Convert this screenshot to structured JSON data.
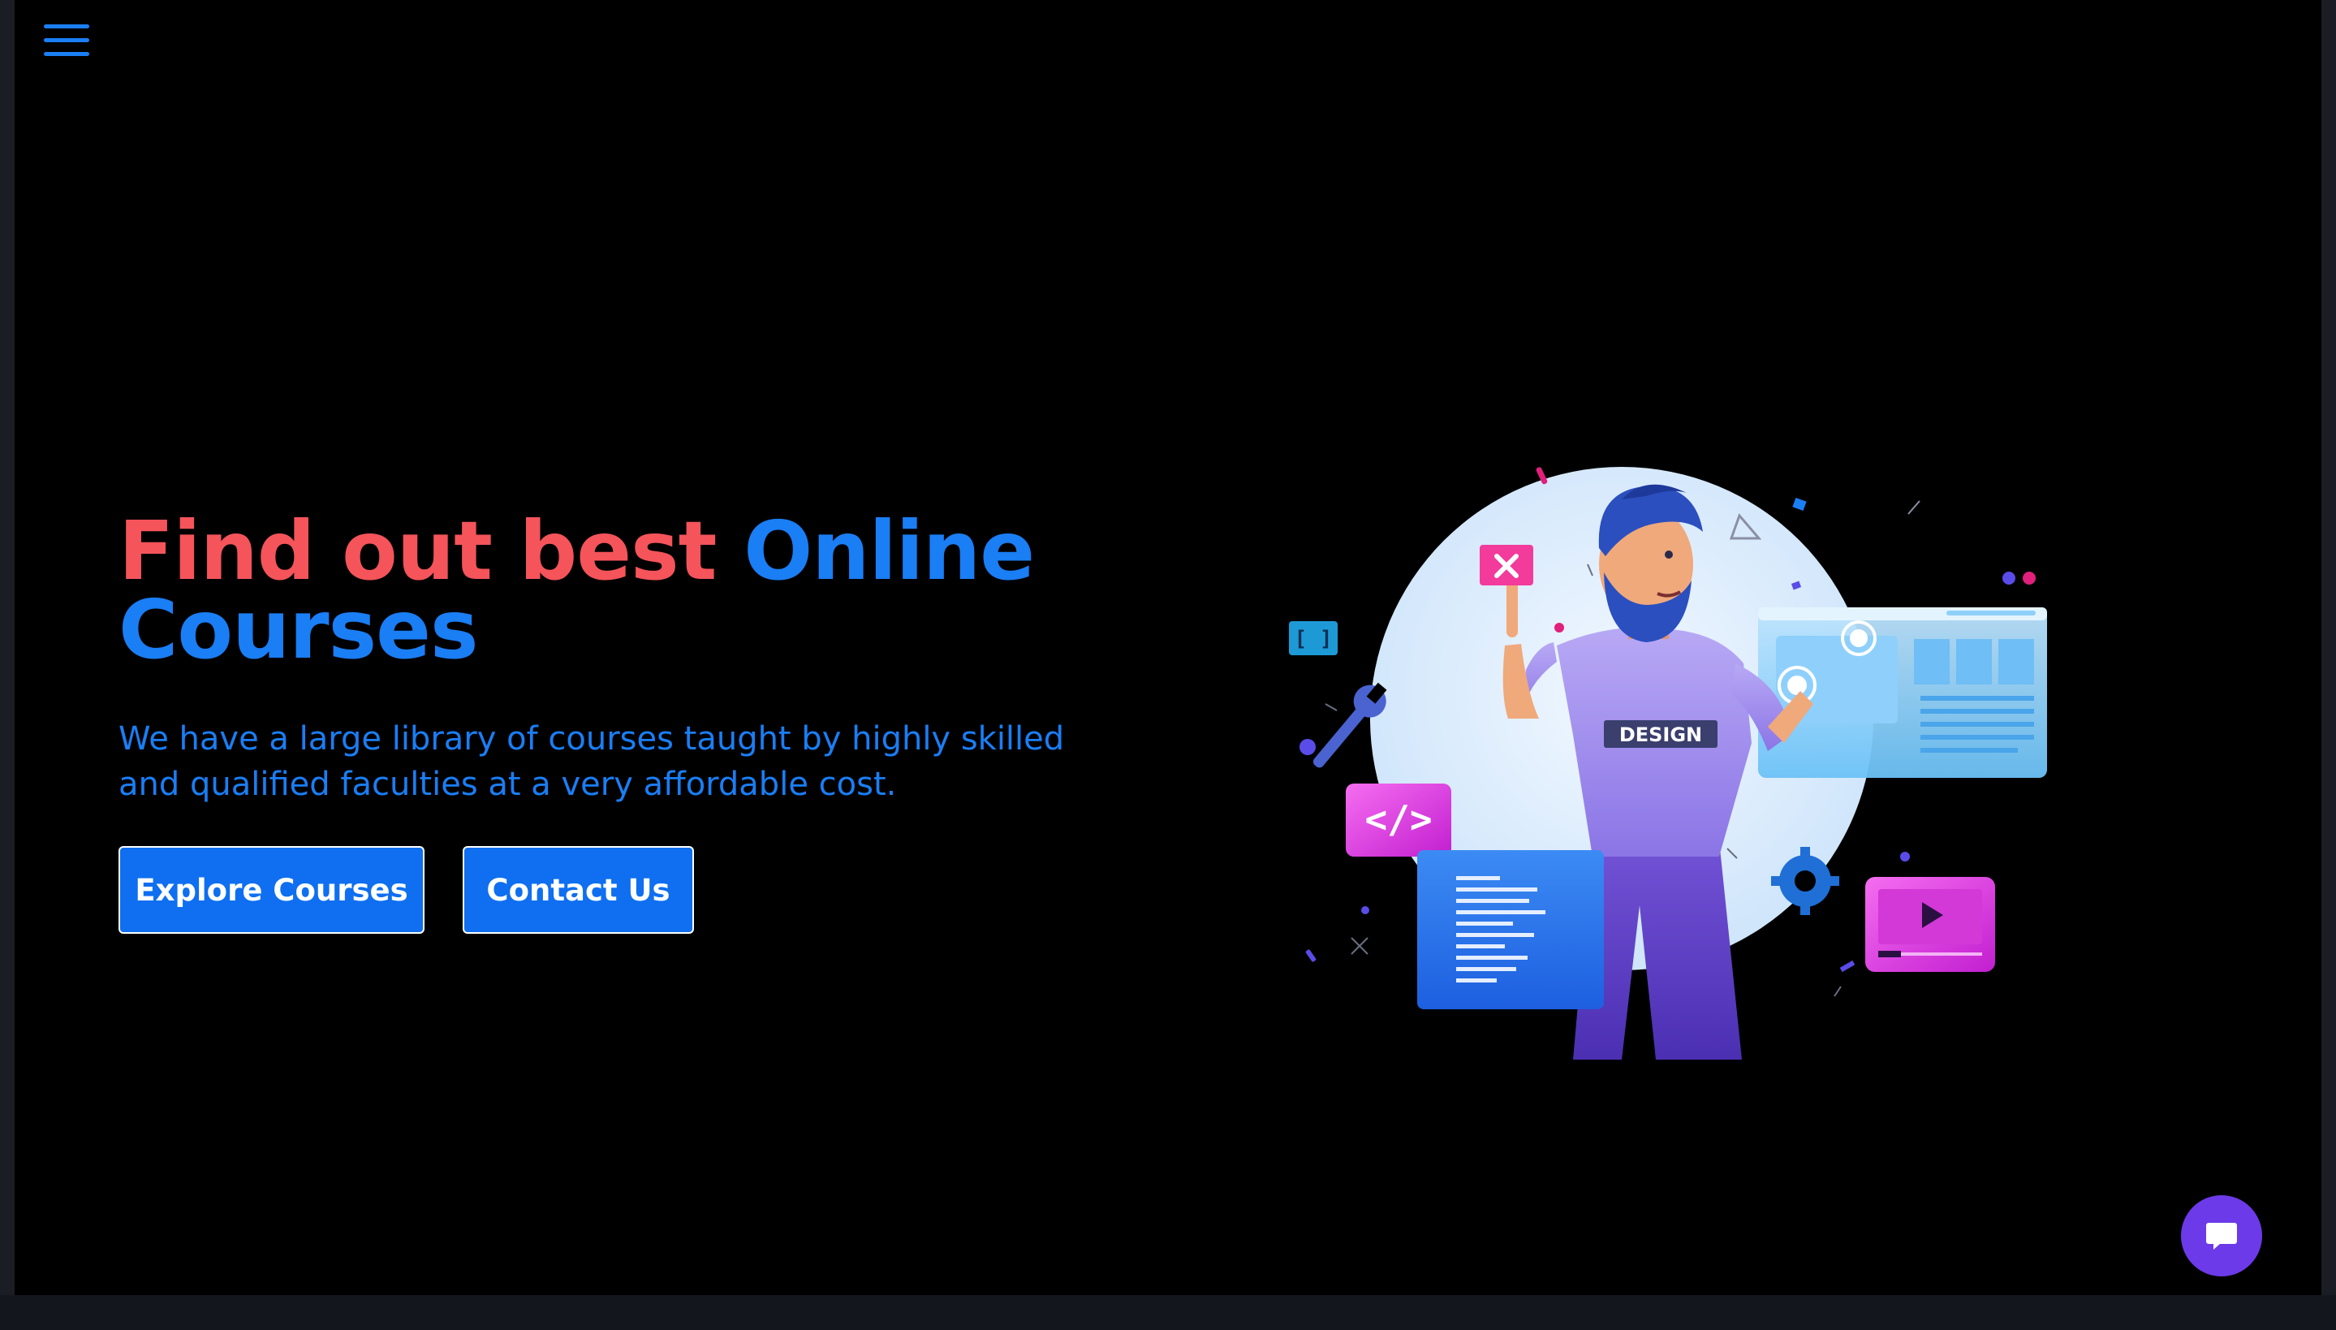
{
  "nav": {
    "menu_icon": "hamburger-menu-icon"
  },
  "hero": {
    "title_part1": "Find out best",
    "title_part2": "Online",
    "title_part3": "Courses",
    "subtitle": "We have a large library of courses taught by highly skilled and qualified faculties at a very affordable cost.",
    "buttons": {
      "explore_label": "Explore Courses",
      "contact_label": "Contact Us"
    },
    "illustration": {
      "badge_text": "DESIGN",
      "code_symbol": "</>",
      "bracket_symbol": "[ ]"
    }
  },
  "chat": {
    "icon": "chat-bubble-icon"
  },
  "colors": {
    "background": "#000000",
    "title_red": "#f4545a",
    "accent_blue": "#1a7ef5",
    "button_blue": "#0f6ff0",
    "chat_purple": "#6c3ae8"
  }
}
